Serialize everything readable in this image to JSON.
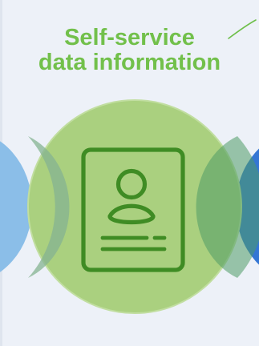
{
  "title": {
    "line1": "Self-service",
    "line2": "data information"
  },
  "colors": {
    "background": "#edf1f8",
    "title": "#72c04b",
    "main_circle": "#a9d07d",
    "main_circle_edge": "#bfdc9e",
    "left_circle": "#7fb8e3",
    "right_circle": "#2f6fd0",
    "icon_stroke": "#3f8c24"
  },
  "icons": {
    "profile": "profile-card-icon",
    "decorative_curve": "curve-line-icon"
  }
}
